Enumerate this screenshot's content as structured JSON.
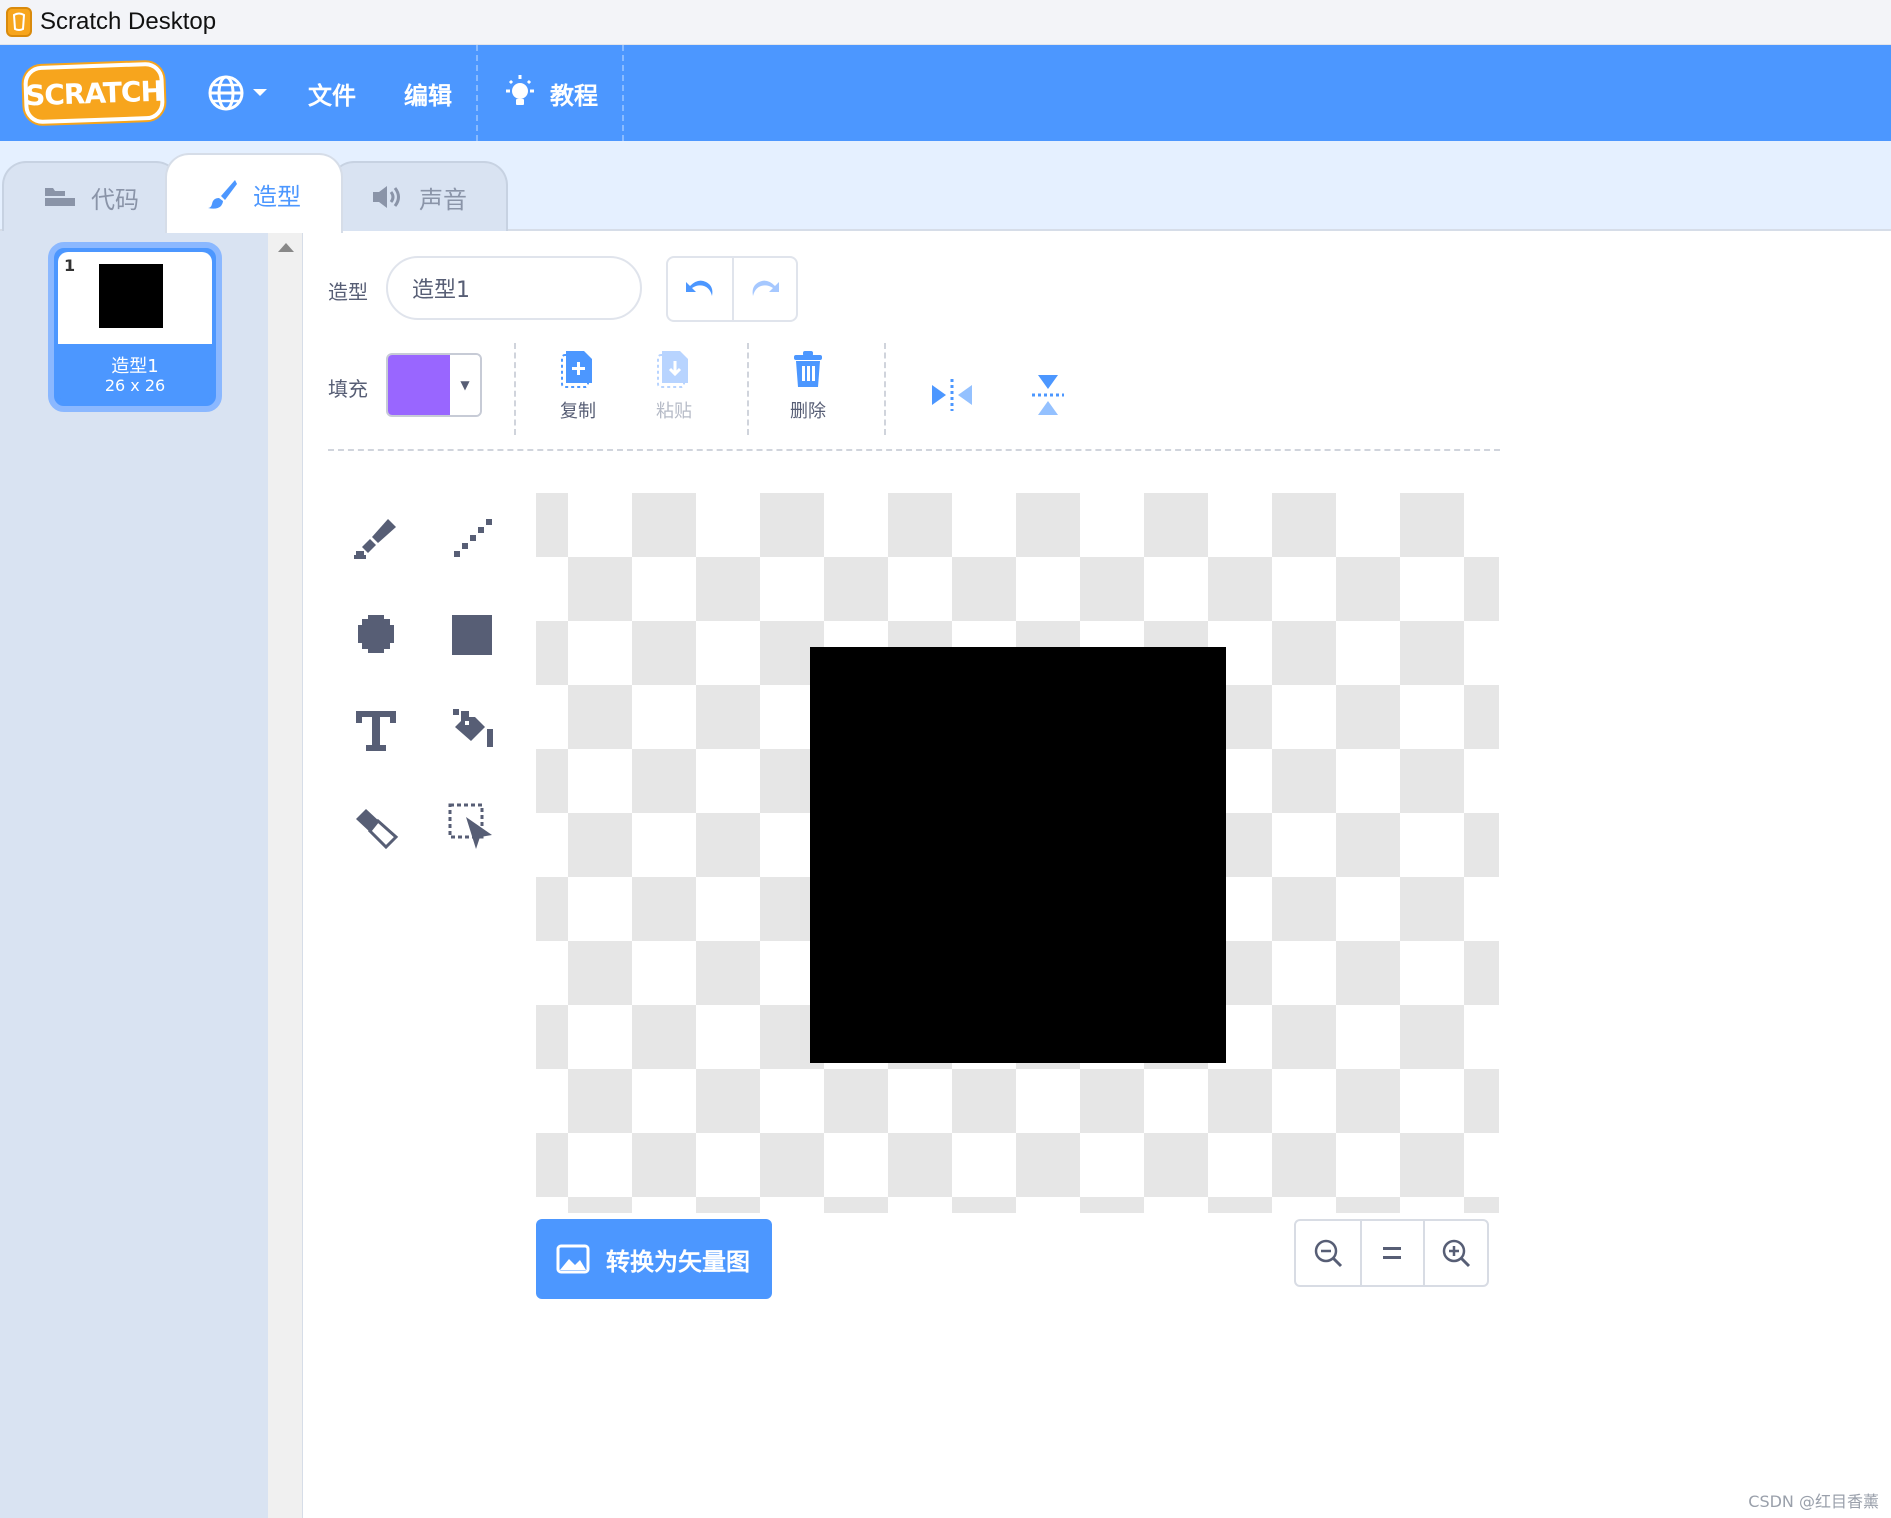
{
  "window": {
    "title": "Scratch Desktop"
  },
  "menubar": {
    "logo_text": "SCRATCH",
    "file": "文件",
    "edit": "编辑",
    "tutorials": "教程"
  },
  "tabs": [
    {
      "label": "代码",
      "active": false
    },
    {
      "label": "造型",
      "active": true
    },
    {
      "label": "声音",
      "active": false
    }
  ],
  "costume_list": {
    "items": [
      {
        "index": "1",
        "name": "造型1",
        "size": "26 x 26",
        "selected": true
      }
    ]
  },
  "editor": {
    "costume_label": "造型",
    "costume_name": "造型1",
    "fill_label": "填充",
    "fill_color": "#9966ff",
    "copy_label": "复制",
    "paste_label": "粘贴",
    "delete_label": "删除",
    "convert_label": "转换为矢量图",
    "tools": [
      "brush-icon",
      "line-icon",
      "circle-icon",
      "rectangle-icon",
      "text-icon",
      "fill-icon",
      "eraser-icon",
      "select-icon"
    ]
  },
  "colors": {
    "menubar": "#4c97ff",
    "accent": "#4c97ff",
    "logo": "#f7a51d"
  },
  "watermark": "CSDN @红目香薰"
}
